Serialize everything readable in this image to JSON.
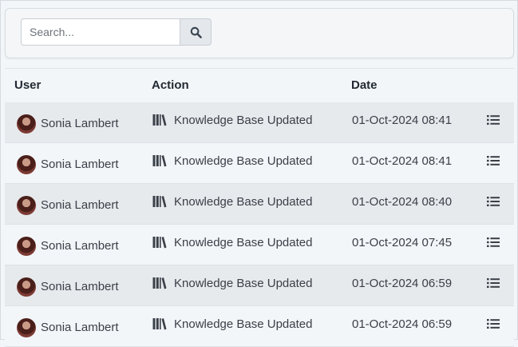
{
  "search": {
    "placeholder": "Search..."
  },
  "table": {
    "headers": {
      "user": "User",
      "action": "Action",
      "date": "Date"
    },
    "rows": [
      {
        "user": "Sonia Lambert",
        "action": "Knowledge Base Updated",
        "date": "01-Oct-2024 08:41"
      },
      {
        "user": "Sonia Lambert",
        "action": "Knowledge Base Updated",
        "date": "01-Oct-2024 08:41"
      },
      {
        "user": "Sonia Lambert",
        "action": "Knowledge Base Updated",
        "date": "01-Oct-2024 08:40"
      },
      {
        "user": "Sonia Lambert",
        "action": "Knowledge Base Updated",
        "date": "01-Oct-2024 07:45"
      },
      {
        "user": "Sonia Lambert",
        "action": "Knowledge Base Updated",
        "date": "01-Oct-2024 06:59"
      },
      {
        "user": "Sonia Lambert",
        "action": "Knowledge Base Updated",
        "date": "01-Oct-2024 06:59"
      }
    ]
  },
  "icons": {
    "search": "search-icon",
    "action": "books-icon",
    "details": "list-icon",
    "avatar": "avatar"
  }
}
